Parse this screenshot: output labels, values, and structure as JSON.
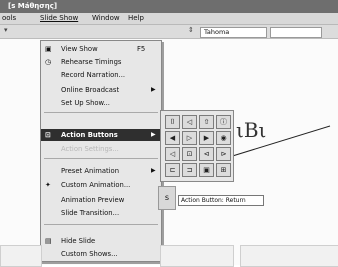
{
  "window": {
    "title": "[s Máθησης]"
  },
  "menubar": {
    "items": [
      "ools",
      "Slide Show",
      "Window",
      "Help"
    ]
  },
  "toolbar": {
    "font_name": "Tahoma",
    "zoom_partial": "5"
  },
  "menu": {
    "items": [
      {
        "label": "View Show",
        "shortcut": "F5",
        "icon": "slideshow-icon"
      },
      {
        "label": "Rehearse Timings",
        "icon": "clock-icon"
      },
      {
        "label": "Record Narration..."
      },
      {
        "label": "Online Broadcast",
        "submenu": true
      },
      {
        "label": "Set Up Show..."
      },
      {
        "label": "Action Buttons",
        "submenu": true,
        "highlighted": true,
        "icon": "action-button-icon"
      },
      {
        "label": "Action Settings...",
        "disabled": true
      },
      {
        "label": "Preset Animation",
        "submenu": true
      },
      {
        "label": "Custom Animation...",
        "icon": "custom-animation-icon"
      },
      {
        "label": "Animation Preview"
      },
      {
        "label": "Slide Transition..."
      },
      {
        "label": "Hide Slide",
        "icon": "hide-slide-icon"
      },
      {
        "label": "Custom Shows..."
      }
    ]
  },
  "submenu": {
    "rows": [
      [
        "⌷",
        "◁",
        "⇧",
        "ⓘ"
      ],
      [
        "◀",
        "▷",
        "▶",
        "◉"
      ],
      [
        "◁",
        "⊡",
        "⊲",
        "⊳"
      ],
      [
        "⊏",
        "⊐",
        "▣",
        "⊞"
      ]
    ]
  },
  "slide": {
    "title_fragment": "ιΒι",
    "callout": "Action Button: Return"
  }
}
